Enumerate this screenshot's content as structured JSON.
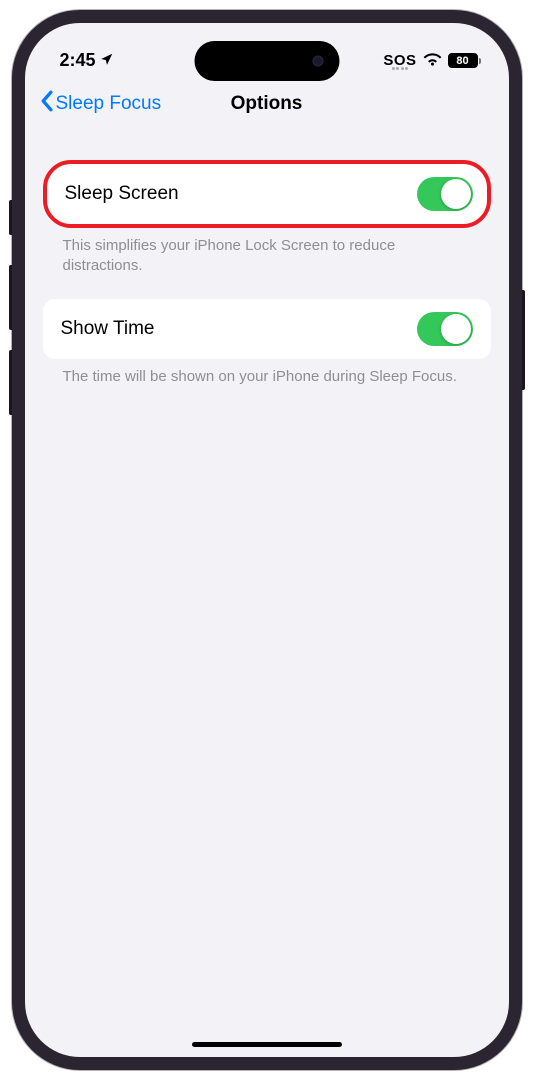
{
  "status": {
    "time": "2:45",
    "sos": "SOS",
    "battery": "80"
  },
  "nav": {
    "back_label": "Sleep Focus",
    "title": "Options"
  },
  "settings": {
    "sleep_screen": {
      "label": "Sleep Screen",
      "description": "This simplifies your iPhone Lock Screen to reduce distractions.",
      "enabled": true
    },
    "show_time": {
      "label": "Show Time",
      "description": "The time will be shown on your iPhone during Sleep Focus.",
      "enabled": true
    }
  },
  "annotation_color": "#ed1c24",
  "accent_color": "#007aff",
  "toggle_on_color": "#34c759"
}
